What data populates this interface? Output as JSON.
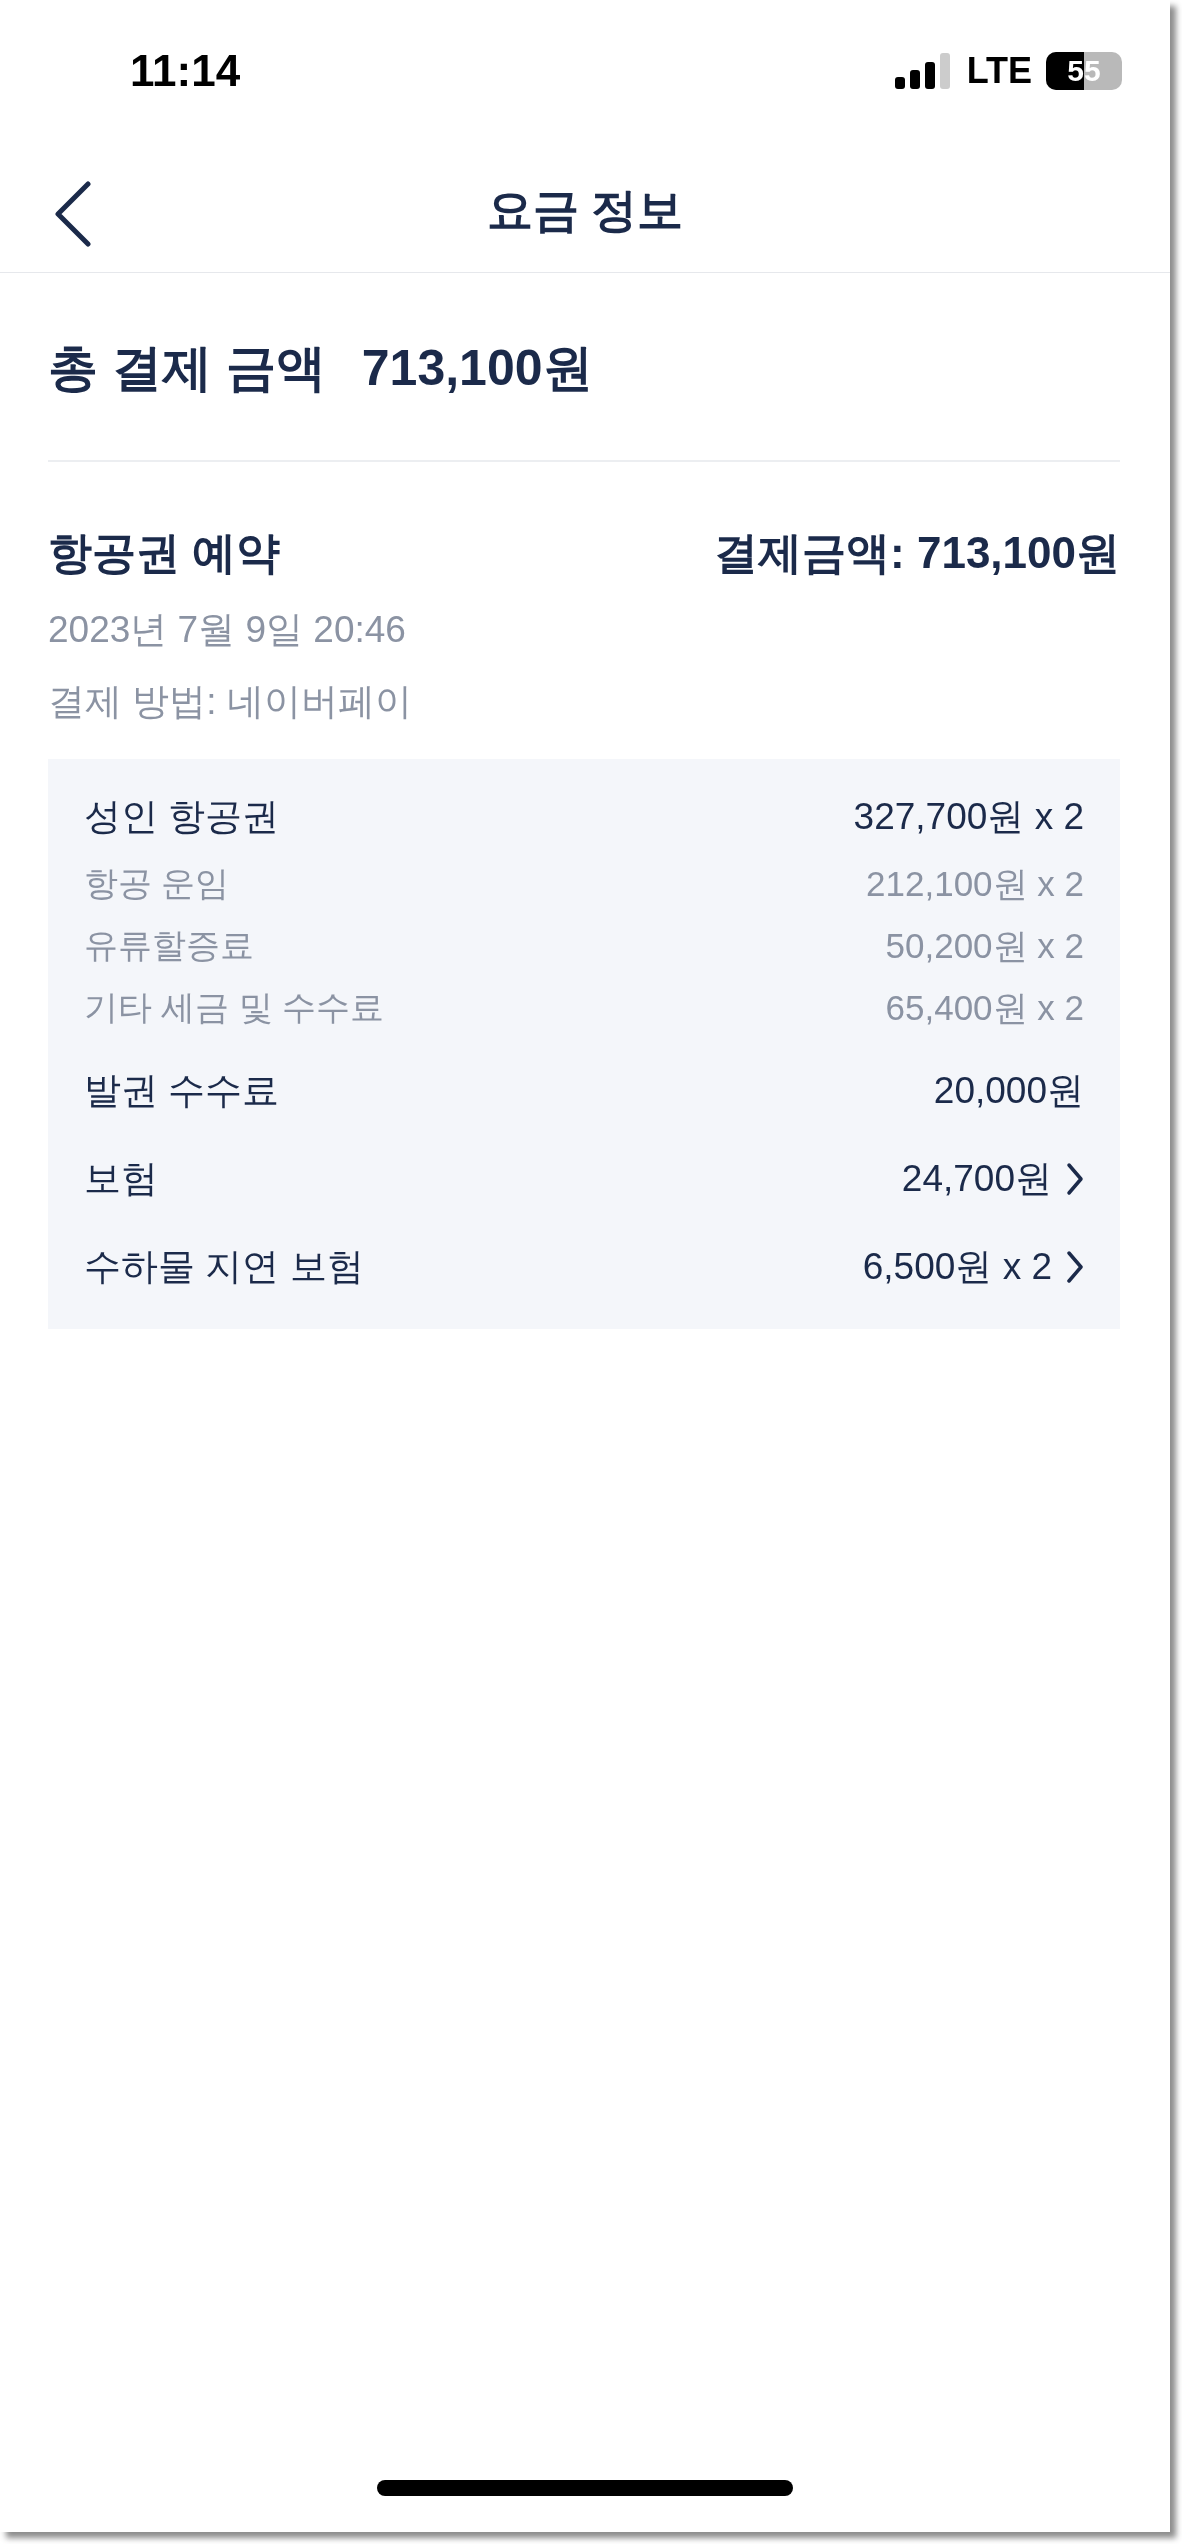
{
  "status_bar": {
    "time": "11:14",
    "network": "LTE",
    "battery": "55"
  },
  "header": {
    "title": "요금 정보"
  },
  "total": {
    "label": "총 결제 금액",
    "amount": "713,100원"
  },
  "booking": {
    "title": "항공권 예약",
    "amount": "결제금액: 713,100원",
    "date": "2023년 7월 9일 20:46",
    "payment_method": "결제 방법: 네이버페이"
  },
  "breakdown": [
    {
      "kind": "main",
      "label": "성인 항공권",
      "value": "327,700원 x 2",
      "chevron": false
    },
    {
      "kind": "sub",
      "label": "항공 운임",
      "value": "212,100원 x 2",
      "chevron": false
    },
    {
      "kind": "sub",
      "label": "유류할증료",
      "value": "50,200원 x 2",
      "chevron": false
    },
    {
      "kind": "sub",
      "label": "기타 세금 및 수수료",
      "value": "65,400원 x 2",
      "chevron": false
    },
    {
      "kind": "main",
      "label": "발권 수수료",
      "value": "20,000원",
      "chevron": false
    },
    {
      "kind": "main",
      "label": "보험",
      "value": "24,700원",
      "chevron": true
    },
    {
      "kind": "main",
      "label": "수하물 지연 보험",
      "value": "6,500원 x 2",
      "chevron": true
    }
  ]
}
